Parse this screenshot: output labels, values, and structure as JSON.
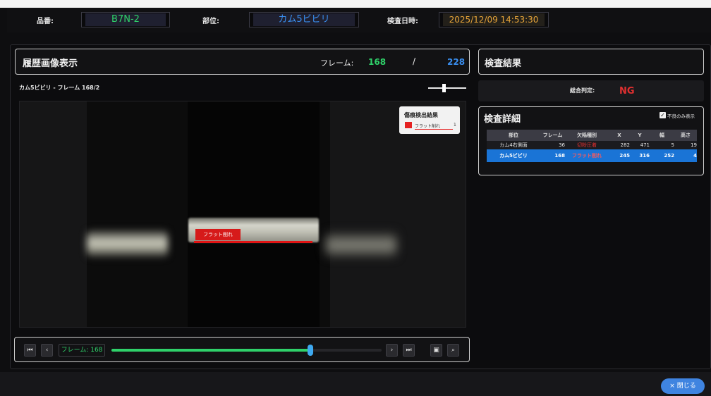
{
  "header": {
    "part_no_label": "品番:",
    "part_no_value": "B7N-2",
    "location_label": "部位:",
    "location_value": "カム5ビビリ",
    "datetime_label": "検査日時:",
    "datetime_value": "2025/12/09 14:53:30"
  },
  "history": {
    "title": "履歴画像表示",
    "frame_label": "フレーム:",
    "frame_current": "168",
    "frame_sep": "/",
    "frame_total": "228",
    "subtitle": "カム5ビビリ - フレーム 168/2"
  },
  "legend": {
    "title": "傷痕検出結果",
    "item_label": "フラット削れ",
    "item_count": "1"
  },
  "overlay": {
    "defect_label": "フラット削れ"
  },
  "controls": {
    "first_icon": "skip-first-icon",
    "prev_icon": "prev-icon",
    "frame_display": "フレーム: 168",
    "next_icon": "next-icon",
    "last_icon": "skip-last-icon",
    "fit_icon": "fit-icon",
    "zoom_icon": "zoom-icon",
    "slider_fraction": 0.737
  },
  "result": {
    "title": "検査結果",
    "overall_label": "総合判定:",
    "overall_value": "NG"
  },
  "details": {
    "title": "検査詳細",
    "checkbox_label": "不良のみ表示",
    "checkbox_checked": true,
    "columns": [
      "部位",
      "フレーム",
      "欠陥種別",
      "X",
      "Y",
      "幅",
      "高さ"
    ],
    "rows": [
      {
        "part": "カム4右側面",
        "frame": "36",
        "type": "切粉圧着",
        "x": "282",
        "y": "471",
        "w": "5",
        "h": "19"
      },
      {
        "part": "カム5ビビリ",
        "frame": "168",
        "type": "フラット削れ",
        "x": "245",
        "y": "316",
        "w": "252",
        "h": "4"
      }
    ]
  },
  "footer": {
    "close_label": "× 閉じる"
  },
  "colors": {
    "green": "#2fd16a",
    "blue": "#3a8ff0",
    "ng_red": "#e03030",
    "amber": "#e6a43a",
    "selected_row": "#1a74d6"
  }
}
